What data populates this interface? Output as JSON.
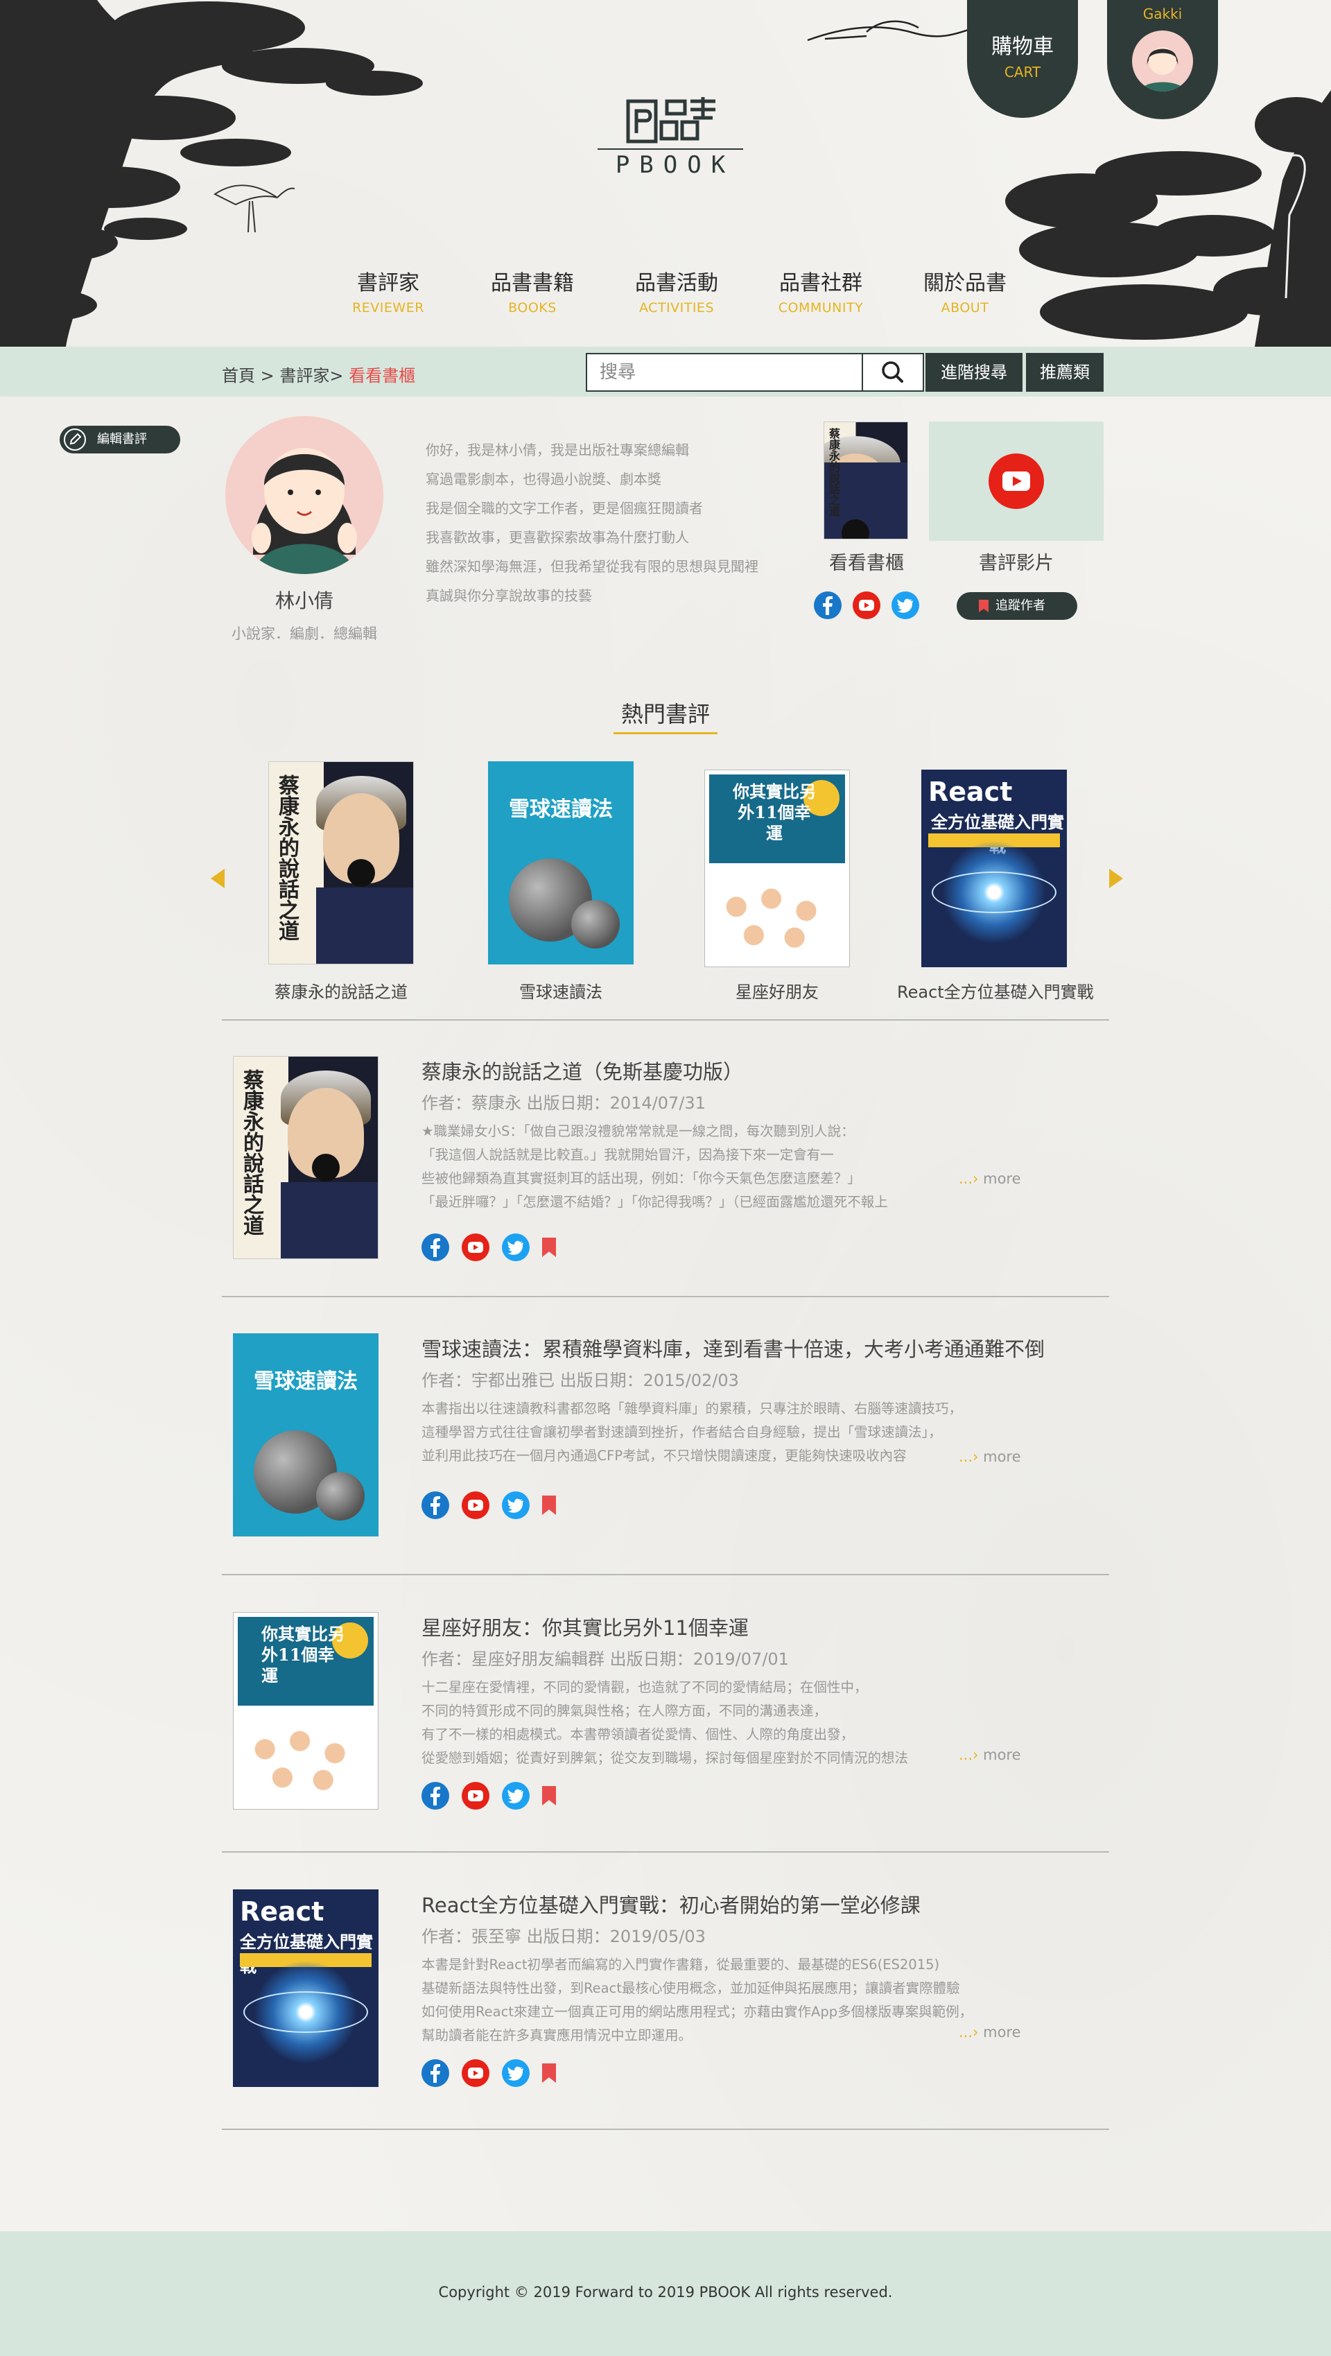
{
  "header": {
    "logo_text": "PBOOK",
    "logo_chars": "品書",
    "cart": {
      "label": "購物車",
      "sub": "CART"
    },
    "user": {
      "name": "Gakki"
    }
  },
  "nav": [
    {
      "zh": "書評家",
      "en": "REVIEWER"
    },
    {
      "zh": "品書書籍",
      "en": "BOOKS"
    },
    {
      "zh": "品書活動",
      "en": "ACTIVITIES"
    },
    {
      "zh": "品書社群",
      "en": "COMMUNITY"
    },
    {
      "zh": "關於品書",
      "en": "ABOUT"
    }
  ],
  "breadcrumb": {
    "home": "首頁",
    "sep1": " > ",
    "reviewer": "書評家",
    "sep2": "> ",
    "current": "看看書櫃"
  },
  "search": {
    "placeholder": "搜尋",
    "advanced": "進階搜尋",
    "recommend": "推薦類"
  },
  "profile": {
    "edit_label": "編輯書評",
    "name": "林小倩",
    "role": "小說家．編劇．總編輯",
    "bio": [
      "你好，我是林小倩，我是出版社專案總編輯",
      "寫過電影劇本，也得過小說獎、劇本獎",
      "我是個全職的文字工作者，更是個瘋狂閱讀者",
      "我喜歡故事，更喜歡探索故事為什麼打動人",
      "雖然深知學海無涯，但我希望從我有限的思想與見聞裡",
      "真誠與你分享說故事的技藝"
    ],
    "bookshelf_label": "看看書櫃",
    "video_label": "書評影片",
    "follow_label": "追蹤作者"
  },
  "hot": {
    "title": "熱門書評",
    "books": [
      {
        "caption": "蔡康永的說話之道"
      },
      {
        "caption": "雪球速讀法"
      },
      {
        "caption": "星座好朋友"
      },
      {
        "caption": "React全方位基礎入門實戰"
      }
    ]
  },
  "covers": {
    "cai_title": "蔡康永的說話之道",
    "snow_title": "雪球速讀法",
    "star_title": "你其實比另外11個幸運",
    "react_t1": "React",
    "react_t2": "全方位基礎入門實戰"
  },
  "reviews": [
    {
      "title": "蔡康永的說話之道（免斯基慶功版）",
      "meta": "作者：蔡康永  出版日期：2014/07/31",
      "excerpt": [
        "★職業婦女小S：「做自己跟沒禮貌常常就是一線之間，每次聽到別人說：",
        "「我這個人說話就是比較直。」我就開始冒汗，因為接下來一定會有一",
        "些被他歸類為直其實挺刺耳的話出現，例如：「你今天氣色怎麼這麼差？」",
        "「最近胖囉？」「怎麼還不結婚？」「你記得我嗎？」（已經面露尷尬還死不報上"
      ],
      "more": "more"
    },
    {
      "title": "雪球速讀法：累積雜學資料庫，達到看書十倍速，大考小考通通難不倒",
      "meta": "作者：宇都出雅已  出版日期：2015/02/03",
      "excerpt": [
        "本書指出以往速讀教科書都忽略「雜學資料庫」的累積，只專注於眼睛、右腦等速讀技巧，",
        "這種學習方式往往會讓初學者對速讀到挫折，作者結合自身經驗，提出「雪球速讀法」，",
        "並利用此技巧在一個月內通過CFP考試，不只增快閱讀速度，更能夠快速吸收內容"
      ],
      "more": "more"
    },
    {
      "title": "星座好朋友：你其實比另外11個幸運",
      "meta": "作者：星座好朋友編輯群  出版日期：2019/07/01",
      "excerpt": [
        "十二星座在愛情裡，不同的愛情觀，也造就了不同的愛情結局；在個性中，",
        "不同的特質形成不同的脾氣與性格；在人際方面，不同的溝通表達，",
        "有了不一樣的相處模式。本書帶領讀者從愛情、個性、人際的角度出發，",
        "從愛戀到婚姻；從責好到脾氣；從交友到職場，探討每個星座對於不同情況的想法"
      ],
      "more": "more"
    },
    {
      "title": "React全方位基礎入門實戰：初心者開始的第一堂必修課",
      "meta": "作者：張至寧  出版日期：2019/05/03",
      "excerpt": [
        "本書是針對React初學者而編寫的入門實作書籍，從最重要的、最基礎的ES6(ES2015)",
        "基礎新語法與特性出發，到React最核心使用概念，並加延伸與拓展應用；讓讀者實際體驗",
        "如何使用React來建立一個真正可用的網站應用程式；亦藉由實作App多個樣版專案與範例，",
        "幫助讀者能在許多真實應用情況中立即運用。"
      ],
      "more": "more"
    }
  ],
  "footer": {
    "copyright": "Copyright © 2019 Forward to 2019 PBOOK All rights reserved."
  },
  "colors": {
    "accent": "#e6b422",
    "dark": "#2f3b39",
    "mint": "#d6e6dc",
    "highlight": "#e84b4b"
  }
}
